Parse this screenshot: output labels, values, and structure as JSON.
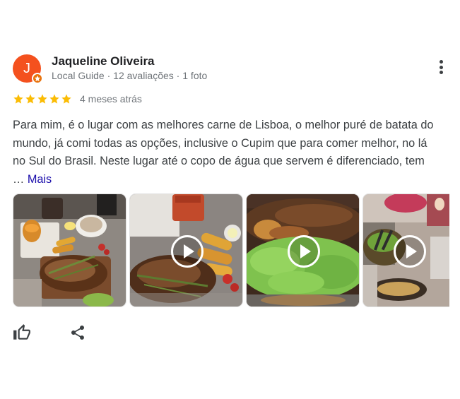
{
  "review": {
    "author": "Jaqueline Oliveira",
    "avatar_letter": "J",
    "meta": {
      "badge": "Local Guide",
      "separator": " · ",
      "reviews": "12 avaliações",
      "photos": "1 foto"
    },
    "rating": 5,
    "date": "4 meses atrás",
    "text": "Para mim, é o lugar com as melhores carne de Lisboa, o melhor puré de batata do mundo, já comi todas as opções, inclusive o Cupim que para comer melhor, no lá no Sul do Brasil. Neste lugar até o copo de água que servem é diferenciado, tem … ",
    "more_label": "Mais"
  },
  "colors": {
    "star": "#fbbc04",
    "avatar": "#f4511e",
    "link": "#1a0dab"
  },
  "photos": [
    {
      "kind": "image"
    },
    {
      "kind": "video"
    },
    {
      "kind": "video"
    },
    {
      "kind": "video"
    }
  ],
  "icons": [
    "more-vert-icon",
    "star-icon",
    "thumb-up-icon",
    "share-icon",
    "play-icon",
    "local-guide-star-icon"
  ]
}
